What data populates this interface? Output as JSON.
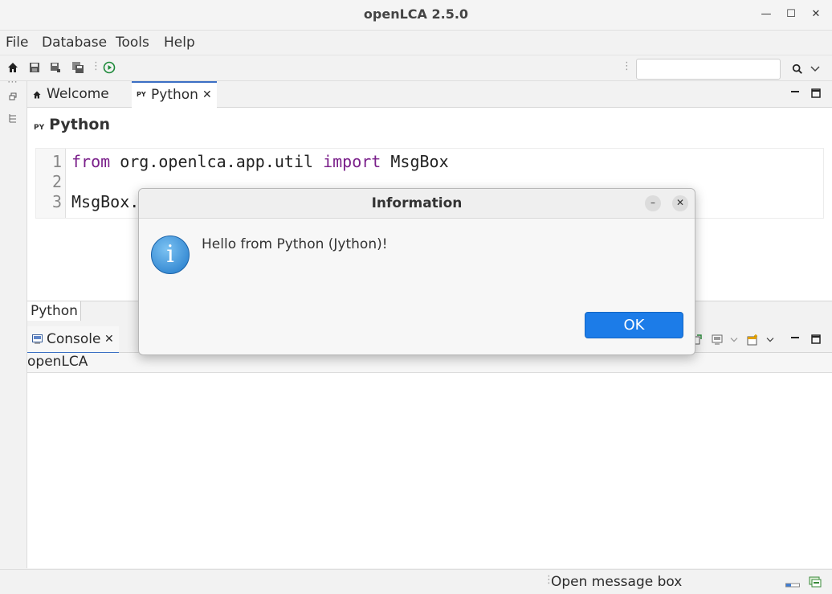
{
  "window": {
    "title": "openLCA 2.5.0"
  },
  "menubar": {
    "items": [
      "File",
      "Database",
      "Tools",
      "Help"
    ]
  },
  "toolbar": {
    "search_value": ""
  },
  "editor_tabs": {
    "welcome_label": "Welcome",
    "python_label": "Python",
    "python_icon_text": "PY"
  },
  "editor": {
    "title": "Python",
    "line_numbers": [
      "1",
      "2",
      "3"
    ],
    "line1": {
      "kw1": "from",
      "mid": " org.openlca.app.util ",
      "kw2": "import",
      "end": " MsgBox"
    },
    "line3": "MsgBox."
  },
  "bottom_tab": {
    "label": "Python"
  },
  "console": {
    "tab_label": "Console",
    "sub_label": "openLCA"
  },
  "statusbar": {
    "text": "Open message box"
  },
  "dialog": {
    "title": "Information",
    "minimize_symbol": "–",
    "close_symbol": "✕",
    "icon_glyph": "i",
    "message": "Hello from Python (Jython)!",
    "ok_label": "OK"
  }
}
